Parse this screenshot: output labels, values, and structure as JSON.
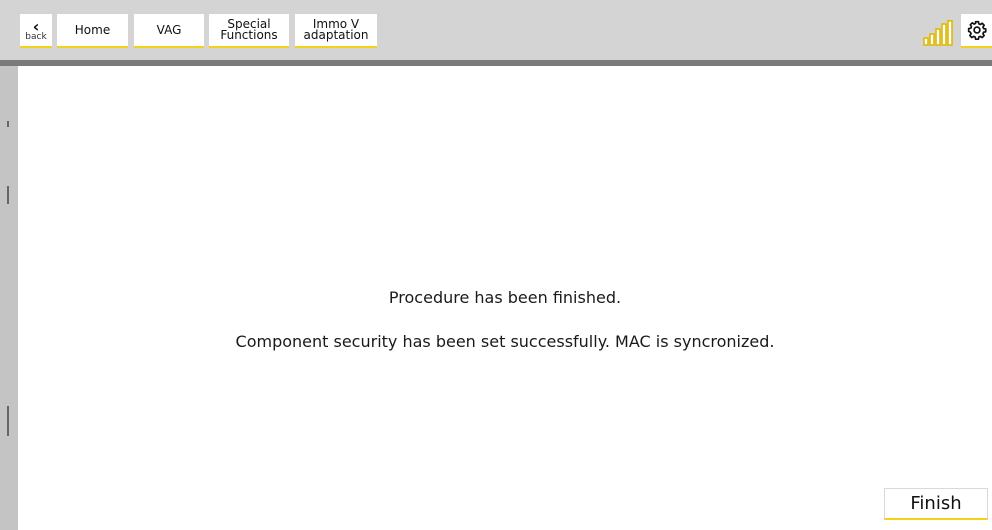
{
  "toolbar": {
    "back_label": "back",
    "crumbs": [
      {
        "label": "Home"
      },
      {
        "label": "VAG"
      },
      {
        "label": "Special\nFunctions"
      },
      {
        "label": "Immo V\nadaptation"
      }
    ],
    "signal_icon": "signal-strength-icon",
    "settings_icon": "gear-icon"
  },
  "main": {
    "message_line1": "Procedure has been finished.",
    "message_line2": "Component security has been set successfully. MAC is syncronized.",
    "finish_label": "Finish"
  },
  "colors": {
    "accent": "#f4d21a",
    "toolbar_bg": "#d4d4d4",
    "content_bg": "#ffffff"
  }
}
